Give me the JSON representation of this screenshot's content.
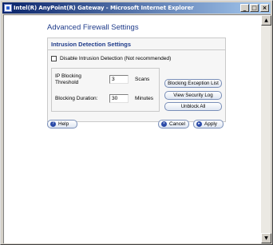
{
  "window": {
    "title": "Intel(R) AnyPoint(R) Gateway - Microsoft Internet Explorer",
    "min_glyph": "_",
    "max_glyph": "□",
    "close_glyph": "×"
  },
  "scrollbar": {
    "up_glyph": "▲",
    "down_glyph": "▼"
  },
  "page": {
    "title": "Advanced Firewall Settings"
  },
  "intrusion": {
    "title": "Intrusion Detection Settings",
    "disable_label": "Disable Intrusion Detection (Not recommended)",
    "disable_checked": false,
    "ip_blocking_label_line1": "IP Blocking",
    "ip_blocking_label_line2": "Threshold",
    "ip_blocking_value": "3",
    "ip_blocking_unit": "Scans",
    "duration_label": "Blocking Duration:",
    "duration_value": "30",
    "duration_unit": "Minutes",
    "buttons": {
      "exception_list": "Blocking Exception List",
      "security_log": "View Security Log",
      "unblock_all": "Unblock All"
    }
  },
  "footer": {
    "help_label": "Help",
    "help_icon": "?",
    "cancel_label": "Cancel",
    "cancel_icon": "×",
    "apply_label": "Apply",
    "apply_icon": "▸"
  }
}
